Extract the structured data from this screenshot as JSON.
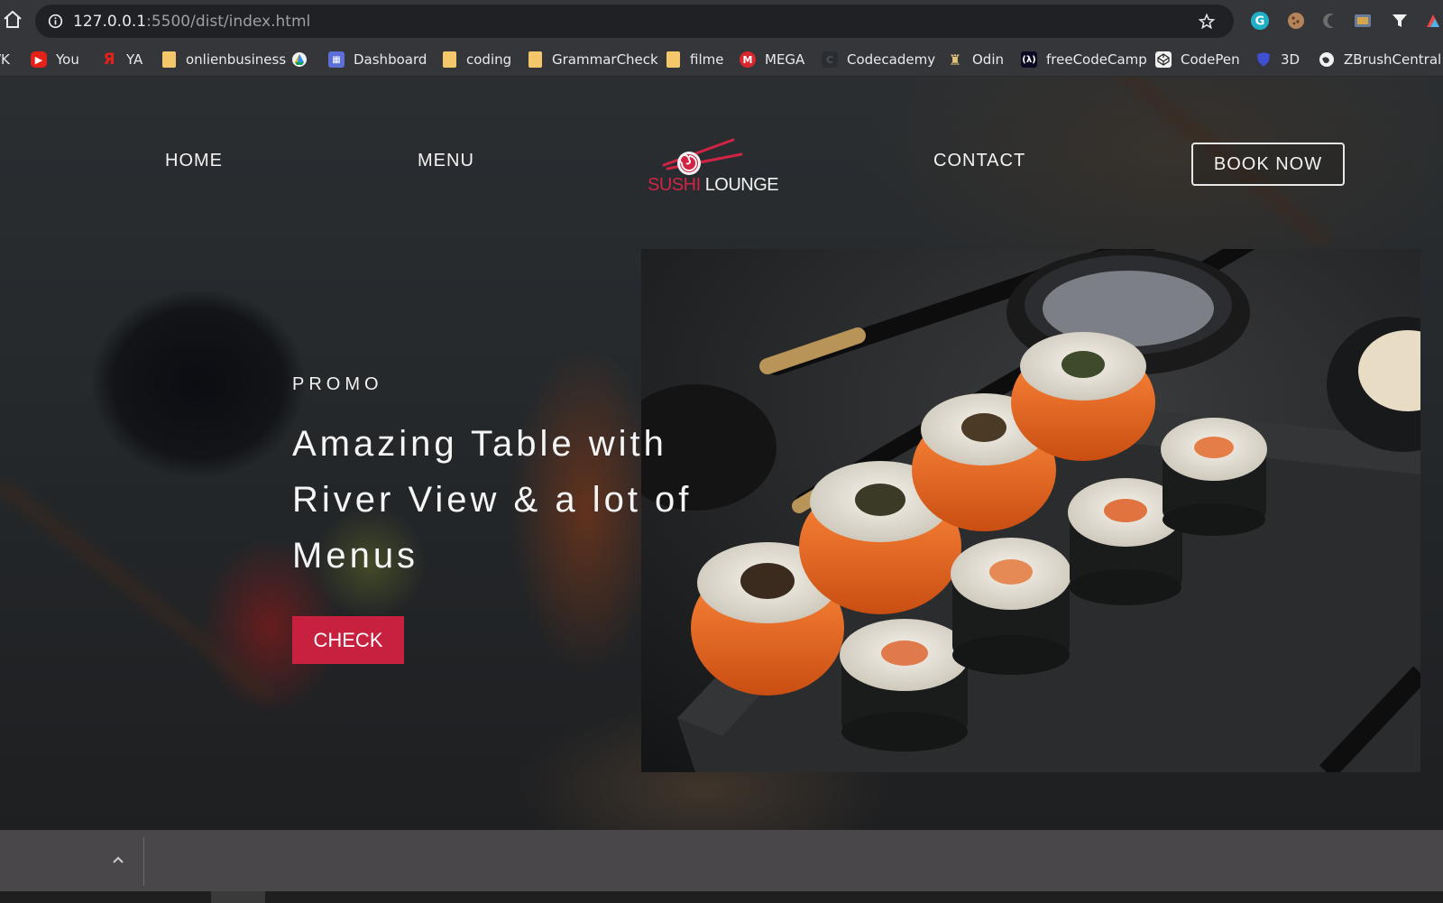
{
  "browser": {
    "url_host": "127.0.0.1",
    "url_path": ":5500/dist/index.html",
    "bookmarks": [
      {
        "label": "/K",
        "icon": "bookmark-icon"
      },
      {
        "label": "You",
        "icon": "youtube-icon"
      },
      {
        "label": "YA",
        "icon": "yandex-icon"
      },
      {
        "label": "onlienbusiness",
        "icon": "folder-icon"
      },
      {
        "label": "",
        "icon": "drive-icon"
      },
      {
        "label": "Dashboard",
        "icon": "dashboard-icon"
      },
      {
        "label": "coding",
        "icon": "folder-icon"
      },
      {
        "label": "GrammarCheck",
        "icon": "folder-icon"
      },
      {
        "label": "filme",
        "icon": "folder-icon"
      },
      {
        "label": "MEGA",
        "icon": "mega-icon"
      },
      {
        "label": "Codecademy",
        "icon": "codecademy-icon"
      },
      {
        "label": "Odin",
        "icon": "odin-icon"
      },
      {
        "label": "freeCodeCamp",
        "icon": "freecodecamp-icon"
      },
      {
        "label": "CodePen",
        "icon": "codepen-icon"
      },
      {
        "label": "3D",
        "icon": "shield-icon"
      },
      {
        "label": "ZBrushCentral - Z",
        "icon": "globe-icon"
      }
    ]
  },
  "site": {
    "nav": {
      "home": "HOME",
      "menu": "MENU",
      "contact": "CONTACT",
      "book_now": "BOOK NOW"
    },
    "logo": {
      "word1": "SUSHI",
      "word2": "LOUNGE"
    },
    "hero": {
      "label": "PROMO",
      "headline_line1": "Amazing Table with",
      "headline_line2": "River View & a lot of",
      "headline_line3": "Menus",
      "cta": "CHECK"
    },
    "colors": {
      "accent": "#c8203f",
      "logo_red": "#d12445",
      "text": "#f2f2f2"
    }
  }
}
